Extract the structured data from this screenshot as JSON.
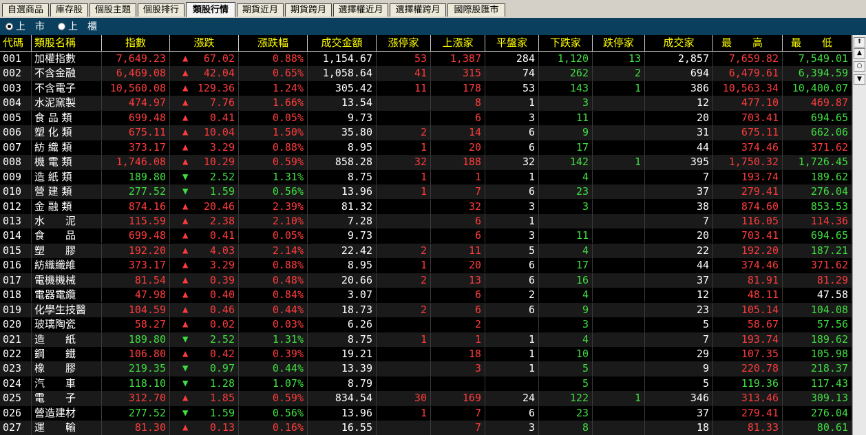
{
  "tabs": [
    {
      "label": "自選商品",
      "active": false
    },
    {
      "label": "庫存股",
      "active": false
    },
    {
      "label": "個股主題",
      "active": false
    },
    {
      "label": "個股排行",
      "active": false
    },
    {
      "label": "類股行情",
      "active": true
    },
    {
      "label": "期貨近月",
      "active": false
    },
    {
      "label": "期貨跨月",
      "active": false
    },
    {
      "label": "選擇權近月",
      "active": false
    },
    {
      "label": "選擇權跨月",
      "active": false
    },
    {
      "label": "國際股匯市",
      "active": false
    }
  ],
  "market": {
    "options": [
      {
        "label": "上　市",
        "selected": true
      },
      {
        "label": "上　櫃",
        "selected": false
      }
    ]
  },
  "table": {
    "headers": [
      "代碼",
      "類股名稱",
      "指數",
      "漲跌",
      "漲跌幅",
      "成交金額",
      "漲停家",
      "上漲家",
      "平盤家",
      "下跌家",
      "跌停家",
      "成交家",
      "最　　高",
      "最　　低"
    ],
    "rows": [
      {
        "code": "001",
        "name": "加權指數",
        "index": "7,649.23",
        "dir": "up",
        "change": "67.02",
        "pct": "0.88%",
        "amount": "1,154.67",
        "limit_up": "53",
        "up": "1,387",
        "flat": "284",
        "down": "1,120",
        "limit_down": "13",
        "traded": "2,857",
        "high": "7,659.82",
        "low": "7,549.01",
        "index_color": "red",
        "high_color": "red",
        "low_color": "green"
      },
      {
        "code": "002",
        "name": "不含金融",
        "index": "6,469.08",
        "dir": "up",
        "change": "42.04",
        "pct": "0.65%",
        "amount": "1,058.64",
        "limit_up": "41",
        "up": "315",
        "flat": "74",
        "down": "262",
        "limit_down": "2",
        "traded": "694",
        "high": "6,479.61",
        "low": "6,394.59",
        "index_color": "red",
        "high_color": "red",
        "low_color": "green"
      },
      {
        "code": "003",
        "name": "不含電子",
        "index": "10,560.08",
        "dir": "up",
        "change": "129.36",
        "pct": "1.24%",
        "amount": "305.42",
        "limit_up": "11",
        "up": "178",
        "flat": "53",
        "down": "143",
        "limit_down": "1",
        "traded": "386",
        "high": "10,563.34",
        "low": "10,400.07",
        "index_color": "red",
        "high_color": "red",
        "low_color": "green"
      },
      {
        "code": "004",
        "name": "水泥窯製",
        "index": "474.97",
        "dir": "up",
        "change": "7.76",
        "pct": "1.66%",
        "amount": "13.54",
        "limit_up": "",
        "up": "8",
        "flat": "1",
        "down": "3",
        "limit_down": "",
        "traded": "12",
        "high": "477.10",
        "low": "469.87",
        "index_color": "red",
        "high_color": "red",
        "low_color": "red"
      },
      {
        "code": "005",
        "name": "食 品 類",
        "index": "699.48",
        "dir": "up",
        "change": "0.41",
        "pct": "0.05%",
        "amount": "9.73",
        "limit_up": "",
        "up": "6",
        "flat": "3",
        "down": "11",
        "limit_down": "",
        "traded": "20",
        "high": "703.41",
        "low": "694.65",
        "index_color": "red",
        "high_color": "red",
        "low_color": "green"
      },
      {
        "code": "006",
        "name": "塑 化 類",
        "index": "675.11",
        "dir": "up",
        "change": "10.04",
        "pct": "1.50%",
        "amount": "35.80",
        "limit_up": "2",
        "up": "14",
        "flat": "6",
        "down": "9",
        "limit_down": "",
        "traded": "31",
        "high": "675.11",
        "low": "662.06",
        "index_color": "red",
        "high_color": "red",
        "low_color": "green"
      },
      {
        "code": "007",
        "name": "紡 織 類",
        "index": "373.17",
        "dir": "up",
        "change": "3.29",
        "pct": "0.88%",
        "amount": "8.95",
        "limit_up": "1",
        "up": "20",
        "flat": "6",
        "down": "17",
        "limit_down": "",
        "traded": "44",
        "high": "374.46",
        "low": "371.62",
        "index_color": "red",
        "high_color": "red",
        "low_color": "red"
      },
      {
        "code": "008",
        "name": "機 電 類",
        "index": "1,746.08",
        "dir": "up",
        "change": "10.29",
        "pct": "0.59%",
        "amount": "858.28",
        "limit_up": "32",
        "up": "188",
        "flat": "32",
        "down": "142",
        "limit_down": "1",
        "traded": "395",
        "high": "1,750.32",
        "low": "1,726.45",
        "index_color": "red",
        "high_color": "red",
        "low_color": "green"
      },
      {
        "code": "009",
        "name": "造 紙 類",
        "index": "189.80",
        "dir": "down",
        "change": "2.52",
        "pct": "1.31%",
        "amount": "8.75",
        "limit_up": "1",
        "up": "1",
        "flat": "1",
        "down": "4",
        "limit_down": "",
        "traded": "7",
        "high": "193.74",
        "low": "189.62",
        "index_color": "green",
        "high_color": "red",
        "low_color": "green"
      },
      {
        "code": "010",
        "name": "營 建 類",
        "index": "277.52",
        "dir": "down",
        "change": "1.59",
        "pct": "0.56%",
        "amount": "13.96",
        "limit_up": "1",
        "up": "7",
        "flat": "6",
        "down": "23",
        "limit_down": "",
        "traded": "37",
        "high": "279.41",
        "low": "276.04",
        "index_color": "green",
        "high_color": "red",
        "low_color": "green"
      },
      {
        "code": "012",
        "name": "金 融 類",
        "index": "874.16",
        "dir": "up",
        "change": "20.46",
        "pct": "2.39%",
        "amount": "81.32",
        "limit_up": "",
        "up": "32",
        "flat": "3",
        "down": "3",
        "limit_down": "",
        "traded": "38",
        "high": "874.60",
        "low": "853.53",
        "index_color": "red",
        "high_color": "red",
        "low_color": "green"
      },
      {
        "code": "013",
        "name": "水　　泥",
        "index": "115.59",
        "dir": "up",
        "change": "2.38",
        "pct": "2.10%",
        "amount": "7.28",
        "limit_up": "",
        "up": "6",
        "flat": "1",
        "down": "",
        "limit_down": "",
        "traded": "7",
        "high": "116.05",
        "low": "114.36",
        "index_color": "red",
        "high_color": "red",
        "low_color": "red"
      },
      {
        "code": "014",
        "name": "食　　品",
        "index": "699.48",
        "dir": "up",
        "change": "0.41",
        "pct": "0.05%",
        "amount": "9.73",
        "limit_up": "",
        "up": "6",
        "flat": "3",
        "down": "11",
        "limit_down": "",
        "traded": "20",
        "high": "703.41",
        "low": "694.65",
        "index_color": "red",
        "high_color": "red",
        "low_color": "green"
      },
      {
        "code": "015",
        "name": "塑　　膠",
        "index": "192.20",
        "dir": "up",
        "change": "4.03",
        "pct": "2.14%",
        "amount": "22.42",
        "limit_up": "2",
        "up": "11",
        "flat": "5",
        "down": "4",
        "limit_down": "",
        "traded": "22",
        "high": "192.20",
        "low": "187.21",
        "index_color": "red",
        "high_color": "red",
        "low_color": "green"
      },
      {
        "code": "016",
        "name": "紡織纖維",
        "index": "373.17",
        "dir": "up",
        "change": "3.29",
        "pct": "0.88%",
        "amount": "8.95",
        "limit_up": "1",
        "up": "20",
        "flat": "6",
        "down": "17",
        "limit_down": "",
        "traded": "44",
        "high": "374.46",
        "low": "371.62",
        "index_color": "red",
        "high_color": "red",
        "low_color": "red"
      },
      {
        "code": "017",
        "name": "電機機械",
        "index": "81.54",
        "dir": "up",
        "change": "0.39",
        "pct": "0.48%",
        "amount": "20.66",
        "limit_up": "2",
        "up": "13",
        "flat": "6",
        "down": "16",
        "limit_down": "",
        "traded": "37",
        "high": "81.91",
        "low": "81.29",
        "index_color": "red",
        "high_color": "red",
        "low_color": "red"
      },
      {
        "code": "018",
        "name": "電器電纜",
        "index": "47.98",
        "dir": "up",
        "change": "0.40",
        "pct": "0.84%",
        "amount": "3.07",
        "limit_up": "",
        "up": "6",
        "flat": "2",
        "down": "4",
        "limit_down": "",
        "traded": "12",
        "high": "48.11",
        "low": "47.58",
        "index_color": "red",
        "high_color": "red",
        "low_color": "white"
      },
      {
        "code": "019",
        "name": "化學生技醫",
        "index": "104.59",
        "dir": "up",
        "change": "0.46",
        "pct": "0.44%",
        "amount": "18.73",
        "limit_up": "2",
        "up": "6",
        "flat": "6",
        "down": "9",
        "limit_down": "",
        "traded": "23",
        "high": "105.14",
        "low": "104.08",
        "index_color": "red",
        "high_color": "red",
        "low_color": "green"
      },
      {
        "code": "020",
        "name": "玻璃陶瓷",
        "index": "58.27",
        "dir": "up",
        "change": "0.02",
        "pct": "0.03%",
        "amount": "6.26",
        "limit_up": "",
        "up": "2",
        "flat": "",
        "down": "3",
        "limit_down": "",
        "traded": "5",
        "high": "58.67",
        "low": "57.56",
        "index_color": "red",
        "high_color": "red",
        "low_color": "green"
      },
      {
        "code": "021",
        "name": "造　　紙",
        "index": "189.80",
        "dir": "down",
        "change": "2.52",
        "pct": "1.31%",
        "amount": "8.75",
        "limit_up": "1",
        "up": "1",
        "flat": "1",
        "down": "4",
        "limit_down": "",
        "traded": "7",
        "high": "193.74",
        "low": "189.62",
        "index_color": "green",
        "high_color": "red",
        "low_color": "green"
      },
      {
        "code": "022",
        "name": "鋼　　鐵",
        "index": "106.80",
        "dir": "up",
        "change": "0.42",
        "pct": "0.39%",
        "amount": "19.21",
        "limit_up": "",
        "up": "18",
        "flat": "1",
        "down": "10",
        "limit_down": "",
        "traded": "29",
        "high": "107.35",
        "low": "105.98",
        "index_color": "red",
        "high_color": "red",
        "low_color": "green"
      },
      {
        "code": "023",
        "name": "橡　　膠",
        "index": "219.35",
        "dir": "down",
        "change": "0.97",
        "pct": "0.44%",
        "amount": "13.39",
        "limit_up": "",
        "up": "3",
        "flat": "1",
        "down": "5",
        "limit_down": "",
        "traded": "9",
        "high": "220.78",
        "low": "218.37",
        "index_color": "green",
        "high_color": "red",
        "low_color": "green"
      },
      {
        "code": "024",
        "name": "汽　　車",
        "index": "118.10",
        "dir": "down",
        "change": "1.28",
        "pct": "1.07%",
        "amount": "8.79",
        "limit_up": "",
        "up": "",
        "flat": "",
        "down": "5",
        "limit_down": "",
        "traded": "5",
        "high": "119.36",
        "low": "117.43",
        "index_color": "green",
        "high_color": "green",
        "low_color": "green"
      },
      {
        "code": "025",
        "name": "電　　子",
        "index": "312.70",
        "dir": "up",
        "change": "1.85",
        "pct": "0.59%",
        "amount": "834.54",
        "limit_up": "30",
        "up": "169",
        "flat": "24",
        "down": "122",
        "limit_down": "1",
        "traded": "346",
        "high": "313.46",
        "low": "309.13",
        "index_color": "red",
        "high_color": "red",
        "low_color": "green"
      },
      {
        "code": "026",
        "name": "營造建材",
        "index": "277.52",
        "dir": "down",
        "change": "1.59",
        "pct": "0.56%",
        "amount": "13.96",
        "limit_up": "1",
        "up": "7",
        "flat": "6",
        "down": "23",
        "limit_down": "",
        "traded": "37",
        "high": "279.41",
        "low": "276.04",
        "index_color": "green",
        "high_color": "red",
        "low_color": "green"
      },
      {
        "code": "027",
        "name": "運　　輸",
        "index": "81.30",
        "dir": "up",
        "change": "0.13",
        "pct": "0.16%",
        "amount": "16.55",
        "limit_up": "",
        "up": "7",
        "flat": "3",
        "down": "8",
        "limit_down": "",
        "traded": "18",
        "high": "81.33",
        "low": "80.61",
        "index_color": "red",
        "high_color": "red",
        "low_color": "green"
      }
    ]
  },
  "colors": {
    "header_text": "#ffff00",
    "up": "#ff3c3c",
    "down": "#40e040",
    "neutral": "#ffffff",
    "market_bar": "#0a3f5e"
  },
  "icons": {
    "up_arrow": "▲",
    "down_arrow": "▼",
    "scroll_top": "⇞",
    "scroll_up": "▲",
    "scroll_mid": "○",
    "scroll_down": "▼"
  }
}
